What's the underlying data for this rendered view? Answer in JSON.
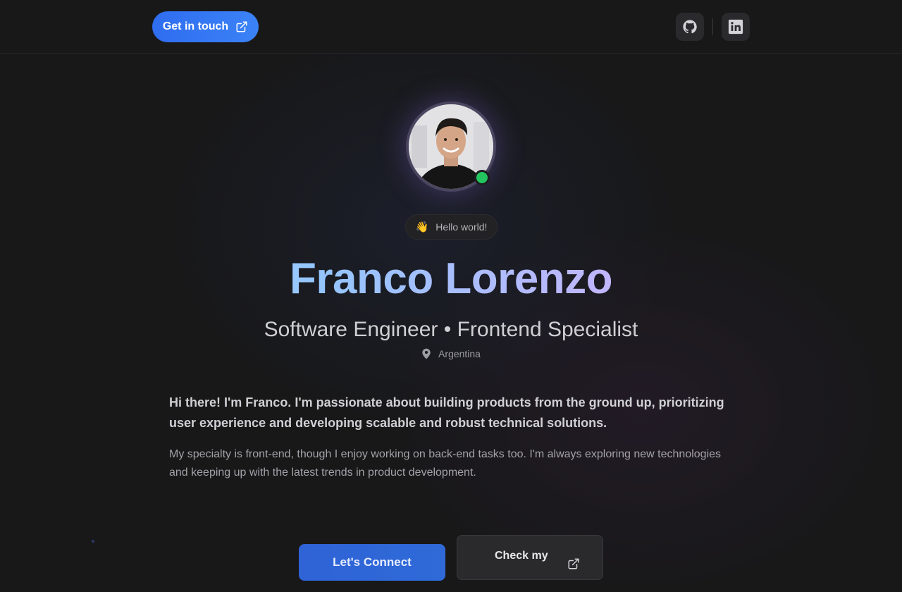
{
  "header": {
    "cta_label": "Get in touch",
    "social": [
      {
        "icon": "github-icon"
      },
      {
        "icon": "linkedin-icon"
      }
    ]
  },
  "profile": {
    "avatar_status": "online",
    "hello_emoji": "👋",
    "hello_text": "Hello world!",
    "name": "Franco Lorenzo",
    "role": "Software Engineer • Frontend Specialist",
    "location": "Argentina"
  },
  "about": {
    "lead": "Hi there! I'm Franco. I'm passionate about building products from the ground up, prioritizing user experience and developing scalable and robust technical solutions.",
    "body": "My specialty is front-end, though I enjoy working on back-end tasks too. I'm always exploring new technologies and keeping up with the latest trends in product development."
  },
  "actions": {
    "connect_label": "Let's Connect",
    "check_label": "Check my"
  },
  "colors": {
    "accent": "#3b82f6",
    "status": "#22c55e",
    "background": "#181819"
  }
}
